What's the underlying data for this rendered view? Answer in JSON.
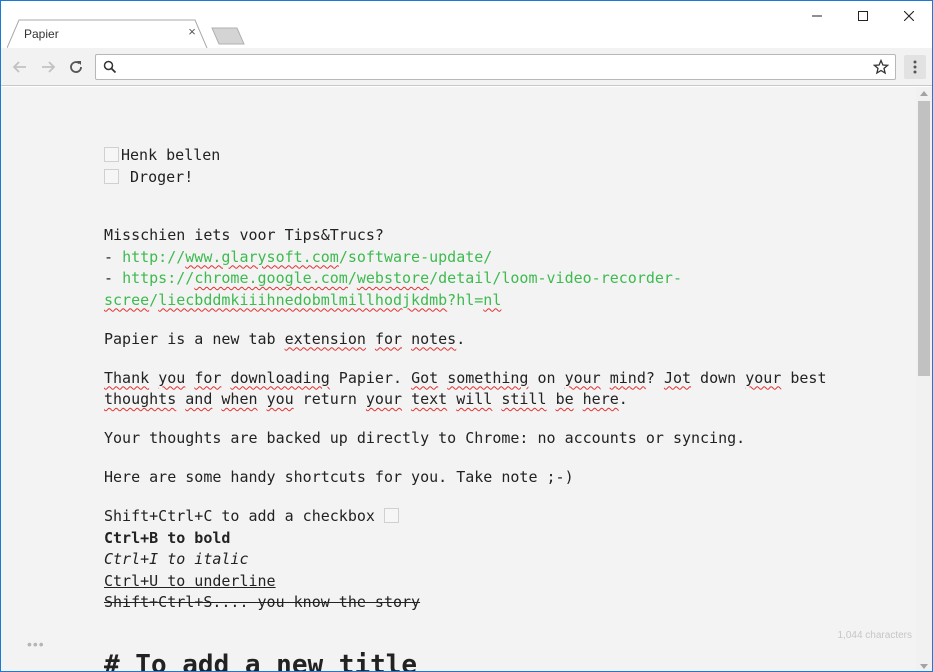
{
  "browser": {
    "tab_title": "Papier",
    "tab_close": "×",
    "omnibox_value": "",
    "omnibox_placeholder": ""
  },
  "note": {
    "checkboxes": [
      {
        "label": "Henk bellen",
        "checked": false
      },
      {
        "label": " Droger!",
        "checked": false
      }
    ],
    "tips_heading": "Misschien iets voor Tips&Trucs?",
    "links": [
      "http://www.glarysoft.com/software-update/",
      "https://chrome.google.com/webstore/detail/loom-video-recorder-scree/liecbddmkiiihnedobmlmillhodjkdmb?hl=nl"
    ],
    "para1": "Papier is a new tab extension for notes.",
    "para2_line1": "Thank you for downloading Papier. Got something on your mind? Jot down your best",
    "para2_line2": "thoughts and when you return your text will still be here.",
    "para3": "Your thoughts are backed up directly to Chrome: no accounts or syncing.",
    "para4": "Here are some handy shortcuts for you. Take note ;-)",
    "shortcut_checkbox": "Shift+Ctrl+C to add a checkbox",
    "shortcut_bold": "Ctrl+B to bold",
    "shortcut_italic": "Ctrl+I to italic",
    "shortcut_underline": "Ctrl+U to underline",
    "shortcut_strike": "Shift+Ctrl+S.... you know the story",
    "title_line": "# To add a new title"
  },
  "footer": {
    "menu_dots": "•••",
    "char_count": "1,044 characters"
  }
}
